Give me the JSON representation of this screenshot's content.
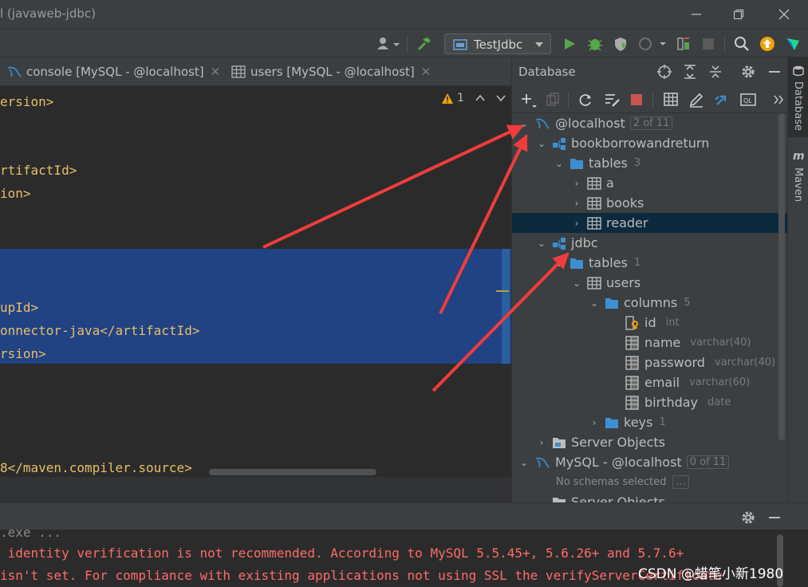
{
  "window": {
    "title": "l (javaweb-jdbc)"
  },
  "toolbar": {
    "run_config": "TestJdbc"
  },
  "editor_tabs": [
    {
      "label": "console [MySQL - @localhost]"
    },
    {
      "label": "users [MySQL - @localhost]"
    }
  ],
  "editor": {
    "warning_count": "1",
    "lines": [
      "ersion>",
      "rtifactId>",
      "ion>",
      "upId>",
      "onnector-java</artifactId>",
      "rsion>",
      "8</maven.compiler.source>"
    ]
  },
  "db_panel": {
    "title": "Database",
    "tree": {
      "host1": {
        "label": "@localhost",
        "badge": "2 of 11"
      },
      "schema1": {
        "label": "bookborrowandreturn"
      },
      "tables1": {
        "label": "tables",
        "count": "3"
      },
      "table_a": {
        "label": "a"
      },
      "table_books": {
        "label": "books"
      },
      "table_reader": {
        "label": "reader"
      },
      "schema2": {
        "label": "jdbc"
      },
      "tables2": {
        "label": "tables",
        "count": "1"
      },
      "table_users": {
        "label": "users"
      },
      "columns": {
        "label": "columns",
        "count": "5"
      },
      "col_id": {
        "label": "id",
        "type": "int"
      },
      "col_name": {
        "label": "name",
        "type": "varchar(40)"
      },
      "col_password": {
        "label": "password",
        "type": "varchar(40)"
      },
      "col_email": {
        "label": "email",
        "type": "varchar(60)"
      },
      "col_birthday": {
        "label": "birthday",
        "type": "date"
      },
      "keys": {
        "label": "keys",
        "count": "1"
      },
      "server_objects": {
        "label": "Server Objects"
      },
      "host2": {
        "label": "MySQL - @localhost",
        "badge": "0 of 11"
      },
      "no_schemas": {
        "label": "No schemas selected",
        "button": "..."
      },
      "server_objects2": {
        "label": "Server Objects"
      }
    }
  },
  "right_strip": {
    "database": "Database",
    "maven": "Maven",
    "maven_icon": "m"
  },
  "console": {
    "line0": ".exe ...",
    "line1": " identity verification is not recommended. According to MySQL 5.5.45+, 5.6.26+ and 5.7.6+",
    "line2": "isn't set. For compliance with existing applications not using SSL the verifyServerCertificate"
  },
  "watermark": "CSDN @蜡笔小新1980",
  "colors": {
    "accent_arrow": "#f03c3c",
    "selection": "#214283",
    "folder": "#3d8fd1",
    "run": "#57a64a",
    "error_text": "#ff6b68"
  }
}
